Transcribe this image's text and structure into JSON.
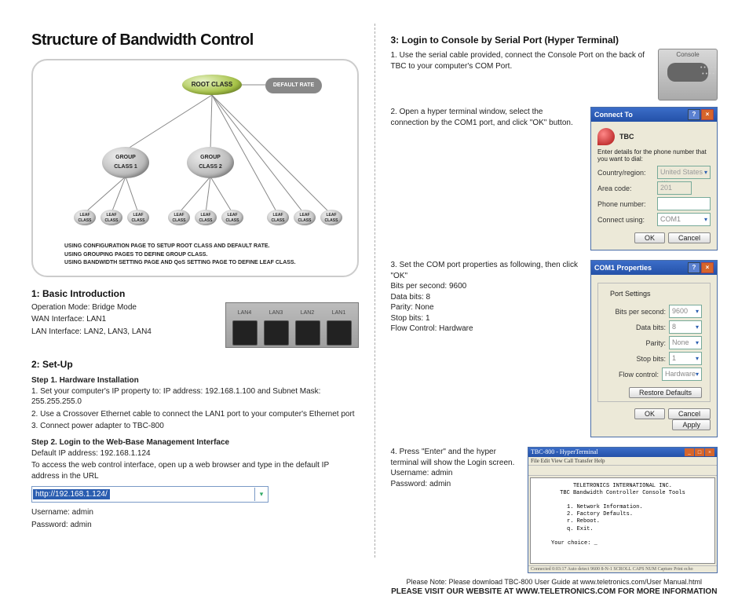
{
  "doc_title": "Structure of Bandwidth Control",
  "diagram": {
    "root": "ROOT CLASS",
    "default_rate": "DEFAULT RATE",
    "group1": "GROUP\nCLASS 1",
    "group2": "GROUP\nCLASS 2",
    "leaf": "LEAF\nCLASS",
    "note1": "USING CONFIGURATION PAGE TO SETUP ROOT CLASS AND DEFAULT RATE.",
    "note2": "USING GROUPING PAGES TO DEFINE GROUP CLASS.",
    "note3": "USING BANDWIDTH SETTING PAGE AND QoS SETTING PAGE TO DEFINE LEAF CLASS."
  },
  "s1": {
    "head": "1: Basic Introduction",
    "l1": "Operation Mode: Bridge Mode",
    "l2": "WAN Interface: LAN1",
    "l3": "LAN Interface: LAN2, LAN3, LAN4",
    "lan4": "LAN4",
    "lan3": "LAN3",
    "lan2": "LAN2",
    "lan1": "LAN1"
  },
  "s2": {
    "head": "2: Set-Up",
    "step1_head": "Step 1. Hardware Installation",
    "step1_l1": "1. Set your computer's IP property to: IP address: 192.168.1.100 and Subnet Mask: 255.255.255.0",
    "step1_l2": "2. Use a Crossover Ethernet cable to connect the LAN1 port to your computer's Ethernet port",
    "step1_l3": "3. Connect power adapter to TBC-800",
    "step2_head": "Step 2. Login to the Web-Base Management Interface",
    "step2_l1": "Default IP address: 192.168.1.124",
    "step2_l2": "To access the web control interface, open up a web browser and type in the default IP address in the URL",
    "url": "http://192.168.1.124/",
    "user_l": "Username: admin",
    "pass_l": "Password: admin"
  },
  "s3": {
    "head": "3: Login to Console by Serial Port (Hyper Terminal)",
    "p1": "1. Use the serial cable provided, connect the Console Port on the back of TBC to your computer's COM Port.",
    "console_label": "Console",
    "p2": "2. Open a hyper terminal window, select the connection by the COM1 port, and click \"OK\" button.",
    "connect_to": {
      "title": "Connect To",
      "name": "TBC",
      "intro": "Enter details for the phone number that you want to dial:",
      "country_l": "Country/region:",
      "country_v": "United States (1)",
      "area_l": "Area code:",
      "area_v": "201",
      "phone_l": "Phone number:",
      "phone_v": "",
      "conn_l": "Connect using:",
      "conn_v": "COM1",
      "ok": "OK",
      "cancel": "Cancel"
    },
    "p3": "3. Set the COM port properties as following, then click \"OK\"",
    "p3a": "Bits per second: 9600",
    "p3b": "Data bits: 8",
    "p3c": "Parity: None",
    "p3d": "Stop bits: 1",
    "p3e": "Flow Control: Hardware",
    "com_props": {
      "title": "COM1 Properties",
      "tab": "Port Settings",
      "bps_l": "Bits per second:",
      "bps_v": "9600",
      "db_l": "Data bits:",
      "db_v": "8",
      "par_l": "Parity:",
      "par_v": "None",
      "sb_l": "Stop bits:",
      "sb_v": "1",
      "fc_l": "Flow control:",
      "fc_v": "Hardware",
      "restore": "Restore Defaults",
      "ok": "OK",
      "cancel": "Cancel",
      "apply": "Apply"
    },
    "p4a": "4. Press \"Enter\" and the hyper terminal will show the Login screen.",
    "p4b": "Username: admin",
    "p4c": "Password: admin",
    "term": {
      "title": "TBC-800 - HyperTerminal",
      "menu": "File  Edit  View  Call  Transfer  Help",
      "l1": "TELETRONICS INTERNATIONAL INC.",
      "l2": "TBC Bandwidth Controller Console Tools",
      "l3": "1. Network Information.",
      "l4": "2. Factory Defaults.",
      "l5": "r. Reboot.",
      "l6": "q. Exit.",
      "l7": "Your choice: _",
      "status": "Connected 0:03:17   Auto detect   9600 8-N-1   SCROLL   CAPS   NUM   Capture   Print echo"
    }
  },
  "footer": {
    "note": "Please Note: Please download TBC-800 User Guide at www.teletronics.com/User Manual.html",
    "pre": "PLEASE VISIT OUR WEBSITE AT ",
    "site": "WWW.TELETRONICS.COM",
    "post": " FOR MORE INFORMATION"
  }
}
